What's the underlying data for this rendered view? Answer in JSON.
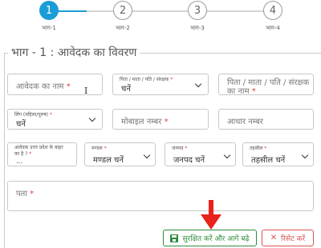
{
  "stepper": {
    "steps": [
      {
        "number": "1",
        "label": "भाग-1",
        "active": true
      },
      {
        "number": "2",
        "label": "भाग-2",
        "active": false
      },
      {
        "number": "3",
        "label": "भाग-3",
        "active": false
      },
      {
        "number": "4",
        "label": "भाग-4",
        "active": false
      }
    ]
  },
  "section": {
    "legend": "भाग - 1 : आवेदक का विवरण"
  },
  "form": {
    "applicant_name": {
      "placeholder": "आवेदक का नाम",
      "required": "*"
    },
    "relation": {
      "label": "पिता / माता / पति / संरक्षक",
      "required": "*",
      "value": "चनें"
    },
    "relation_name": {
      "placeholder_line1": "पिता / माता / पति / संरक्षक",
      "placeholder_line2": "का नाम",
      "required": "*"
    },
    "gender": {
      "label": "लिंग (महिला/पुरुष)",
      "required": "*",
      "value": "चनें"
    },
    "mobile": {
      "placeholder": "मोबाइल नम्बर",
      "required": "*"
    },
    "aadhaar": {
      "placeholder": "आधार नम्बर"
    },
    "outside_state": {
      "label_line1": "आवेदक उत्तर प्रदेश के बाहर",
      "label_line2": "का है ?",
      "required": "*",
      "value": "..."
    },
    "division": {
      "label": "मण्डल",
      "required": "*",
      "value": "मण्डल चनें"
    },
    "district": {
      "label": "जनपद",
      "required": "*",
      "value": "जनपद चनें"
    },
    "tehsil": {
      "label": "तहसील",
      "required": "*",
      "value": "तहसील चनें"
    },
    "address": {
      "placeholder": "पता",
      "required": "*"
    }
  },
  "actions": {
    "save_label": "सुरक्षित करें और आगे बढ़े",
    "reset_label": "रिसेट करें"
  },
  "colors": {
    "accent": "#1a9cd8",
    "save": "#2e8b3a",
    "reset": "#d9534f",
    "required": "#e53935",
    "arrow": "#e8231b"
  }
}
